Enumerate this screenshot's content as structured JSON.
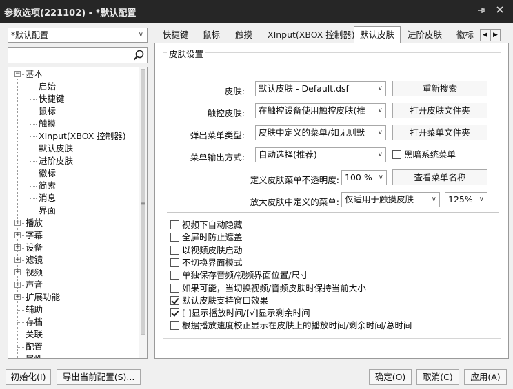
{
  "window": {
    "title": "参数选项(221102) - *默认配置",
    "pin_icon": "pin-icon",
    "close_icon": "close-icon"
  },
  "left": {
    "profile_value": "*默认配置",
    "search_value": "",
    "tree": [
      {
        "label": "基本",
        "level": 0,
        "expander": "−"
      },
      {
        "label": "启始",
        "level": 1
      },
      {
        "label": "快捷键",
        "level": 1
      },
      {
        "label": "鼠标",
        "level": 1
      },
      {
        "label": "触摸",
        "level": 1
      },
      {
        "label": "XInput(XBOX 控制器)",
        "level": 1
      },
      {
        "label": "默认皮肤",
        "level": 1
      },
      {
        "label": "进阶皮肤",
        "level": 1
      },
      {
        "label": "徽标",
        "level": 1
      },
      {
        "label": "简索",
        "level": 1
      },
      {
        "label": "消息",
        "level": 1
      },
      {
        "label": "界面",
        "level": 1
      },
      {
        "label": "播放",
        "level": 0,
        "expander": "+"
      },
      {
        "label": "字幕",
        "level": 0,
        "expander": "+"
      },
      {
        "label": "设备",
        "level": 0,
        "expander": "+"
      },
      {
        "label": "滤镜",
        "level": 0,
        "expander": "+"
      },
      {
        "label": "视频",
        "level": 0,
        "expander": "+"
      },
      {
        "label": "声音",
        "level": 0,
        "expander": "+"
      },
      {
        "label": "扩展功能",
        "level": 0,
        "expander": "+"
      },
      {
        "label": "辅助",
        "level": 0
      },
      {
        "label": "存档",
        "level": 0
      },
      {
        "label": "关联",
        "level": 0
      },
      {
        "label": "配置",
        "level": 0
      },
      {
        "label": "属性",
        "level": 0
      }
    ]
  },
  "tabs": [
    "快捷键",
    "鼠标",
    "触摸",
    "XInput(XBOX 控制器)",
    "默认皮肤",
    "进阶皮肤",
    "徽标"
  ],
  "active_tab": "默认皮肤",
  "group_title": "皮肤设置",
  "form": {
    "skin_label": "皮肤:",
    "skin_value": "默认皮肤 - Default.dsf",
    "rescan": "重新搜索",
    "touch_label": "触控皮肤:",
    "touch_value": "在触控设备使用触控皮肤(推",
    "open_skin_folder": "打开皮肤文件夹",
    "popup_label": "弹出菜单类型:",
    "popup_value": "皮肤中定义的菜单/如无则默",
    "open_menu_folder": "打开菜单文件夹",
    "menu_out_label": "菜单输出方式:",
    "menu_out_value": "自动选择(推荐)",
    "dark_menu": "黑暗系统菜单",
    "opacity_label": "定义皮肤菜单不透明度:",
    "opacity_value": "100 %",
    "view_menu_names": "查看菜单名称",
    "enlarge_label": "放大皮肤中定义的菜单:",
    "enlarge_value": "仅适用于触摸皮肤",
    "enlarge_pct": "125%"
  },
  "checkboxes": [
    {
      "label": "视频下自动隐藏",
      "checked": false
    },
    {
      "label": "全屏时防止遮盖",
      "checked": false
    },
    {
      "label": "以视频皮肤启动",
      "checked": false
    },
    {
      "label": "不切换界面模式",
      "checked": false
    },
    {
      "label": "单独保存音频/视频界面位置/尺寸",
      "checked": false
    },
    {
      "label": "如果可能，当切换视频/音频皮肤时保持当前大小",
      "checked": false
    },
    {
      "label": "默认皮肤支持窗口效果",
      "checked": true
    },
    {
      "label": "[  ]显示播放时间/[√]显示剩余时间",
      "checked": true
    },
    {
      "label": "根据播放速度校正显示在皮肤上的播放时间/剩余时间/总时间",
      "checked": false
    }
  ],
  "bottom": {
    "init": "初始化(I)",
    "export": "导出当前配置(S)...",
    "ok": "确定(O)",
    "cancel": "取消(C)",
    "apply": "应用(A)"
  }
}
